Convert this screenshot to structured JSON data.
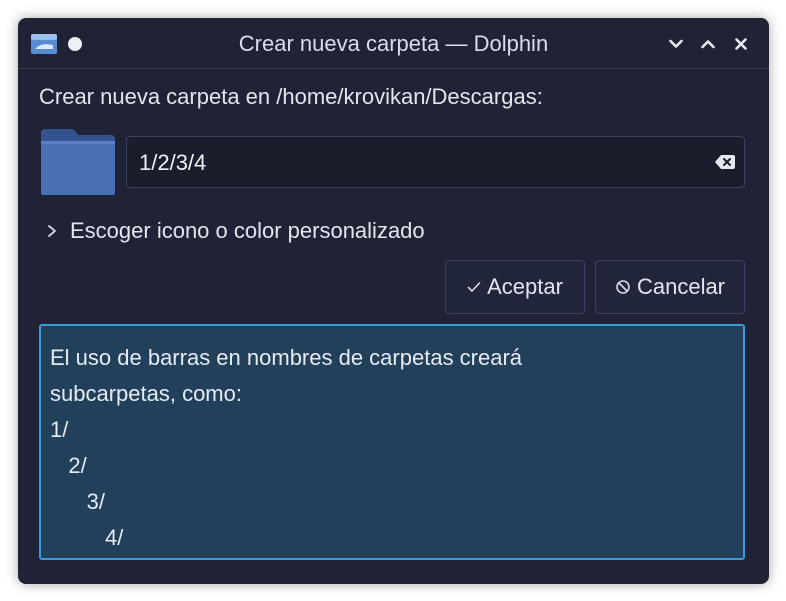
{
  "window": {
    "title": "Crear nueva carpeta — Dolphin",
    "buttons": [
      "minimize",
      "maximize",
      "close"
    ]
  },
  "dialog": {
    "heading": "Crear nueva carpeta en /home/krovikan/Descargas:",
    "name_value": "1/2/3/4",
    "expander_label": "Escoger icono o color personalizado",
    "ok_label": "Aceptar",
    "cancel_label": "Cancelar",
    "message_lines": [
      "El uso de barras en nombres de carpetas creará",
      "subcarpetas, como:",
      "1/",
      "   2/",
      "      3/",
      "         4/"
    ]
  },
  "colors": {
    "window_bg": "#202335",
    "accent": "#3a9ad7",
    "message_bg": "#23405a",
    "folder_blue": "#4a6fb5"
  },
  "icons": [
    "dolphin-app-icon",
    "pin-icon",
    "chevron-down-icon",
    "chevron-up-icon",
    "close-icon",
    "folder-icon",
    "clear-text-icon",
    "chevron-right-icon",
    "checkmark-icon",
    "cancel-icon"
  ]
}
